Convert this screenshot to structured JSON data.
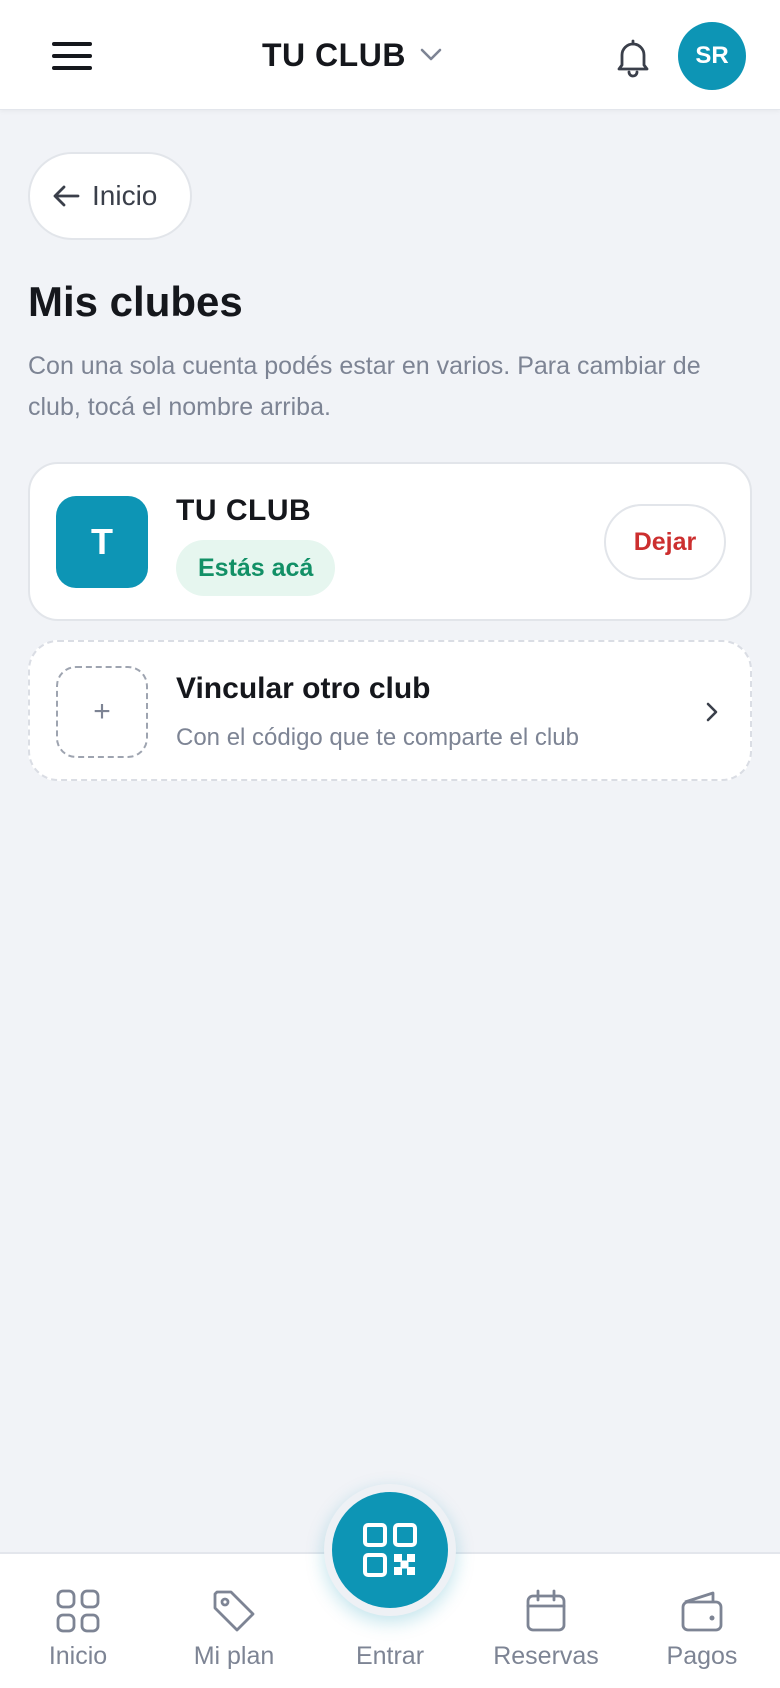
{
  "header": {
    "club_name": "TU CLUB",
    "avatar_initials": "SR"
  },
  "back": {
    "label": "Inicio"
  },
  "page": {
    "title": "Mis clubes",
    "description": "Con una sola cuenta podés estar en varios. Para cambiar de club, tocá el nombre arriba."
  },
  "clubs": [
    {
      "initial": "T",
      "name": "TU CLUB",
      "badge": "Estás acá",
      "action_label": "Dejar"
    }
  ],
  "link_club": {
    "plus": "+",
    "title": "Vincular otro club",
    "subtitle": "Con el código que te comparte el club"
  },
  "bottom_nav": {
    "items": [
      {
        "label": "Inicio",
        "icon": "grid-icon"
      },
      {
        "label": "Mi plan",
        "icon": "tag-icon"
      },
      {
        "label": "Entrar",
        "icon": "qr-code-icon"
      },
      {
        "label": "Reservas",
        "icon": "calendar-icon"
      },
      {
        "label": "Pagos",
        "icon": "wallet-icon"
      }
    ]
  },
  "colors": {
    "accent": "#0d95b5",
    "danger": "#cc2f2f",
    "success": "#129066",
    "success_bg": "#e6f6ef",
    "background": "#f1f3f7"
  }
}
